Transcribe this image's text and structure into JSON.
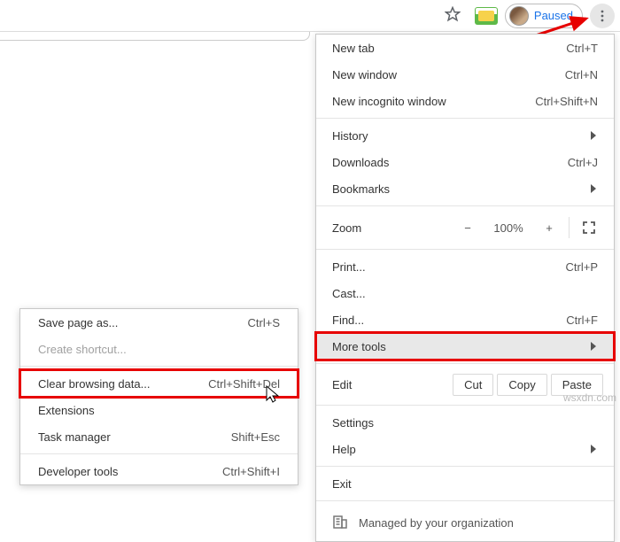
{
  "toolbar": {
    "paused_label": "Paused"
  },
  "menu": {
    "new_tab": {
      "label": "New tab",
      "shortcut": "Ctrl+T"
    },
    "new_window": {
      "label": "New window",
      "shortcut": "Ctrl+N"
    },
    "new_incognito": {
      "label": "New incognito window",
      "shortcut": "Ctrl+Shift+N"
    },
    "history": {
      "label": "History"
    },
    "downloads": {
      "label": "Downloads",
      "shortcut": "Ctrl+J"
    },
    "bookmarks": {
      "label": "Bookmarks"
    },
    "zoom": {
      "label": "Zoom",
      "minus": "−",
      "value": "100%",
      "plus": "+"
    },
    "print": {
      "label": "Print...",
      "shortcut": "Ctrl+P"
    },
    "cast": {
      "label": "Cast..."
    },
    "find": {
      "label": "Find...",
      "shortcut": "Ctrl+F"
    },
    "more_tools": {
      "label": "More tools"
    },
    "edit": {
      "label": "Edit",
      "cut": "Cut",
      "copy": "Copy",
      "paste": "Paste"
    },
    "settings": {
      "label": "Settings"
    },
    "help": {
      "label": "Help"
    },
    "exit": {
      "label": "Exit"
    },
    "org": {
      "label": "Managed by your organization"
    }
  },
  "submenu": {
    "save_page": {
      "label": "Save page as...",
      "shortcut": "Ctrl+S"
    },
    "create_shortcut": {
      "label": "Create shortcut..."
    },
    "clear_data": {
      "label": "Clear browsing data...",
      "shortcut": "Ctrl+Shift+Del"
    },
    "extensions": {
      "label": "Extensions"
    },
    "task_manager": {
      "label": "Task manager",
      "shortcut": "Shift+Esc"
    },
    "dev_tools": {
      "label": "Developer tools",
      "shortcut": "Ctrl+Shift+I"
    }
  },
  "watermark": "wsxdn.com"
}
